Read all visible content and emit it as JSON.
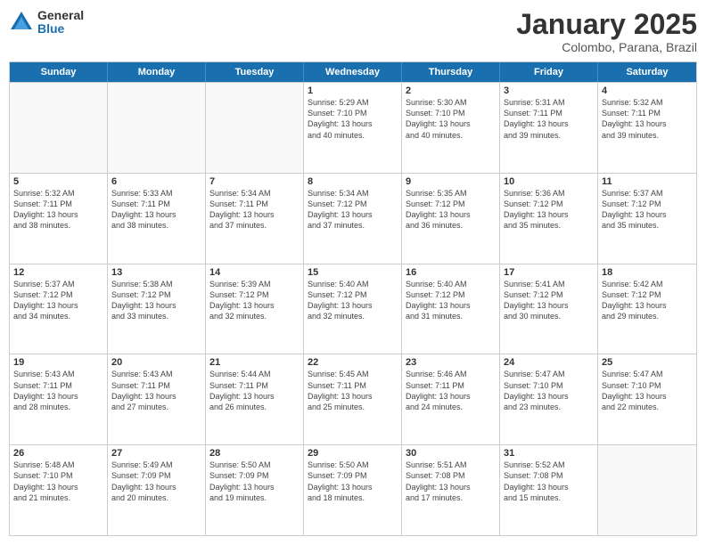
{
  "logo": {
    "general": "General",
    "blue": "Blue"
  },
  "title": "January 2025",
  "location": "Colombo, Parana, Brazil",
  "days_header": [
    "Sunday",
    "Monday",
    "Tuesday",
    "Wednesday",
    "Thursday",
    "Friday",
    "Saturday"
  ],
  "weeks": [
    [
      {
        "day": "",
        "info": ""
      },
      {
        "day": "",
        "info": ""
      },
      {
        "day": "",
        "info": ""
      },
      {
        "day": "1",
        "info": "Sunrise: 5:29 AM\nSunset: 7:10 PM\nDaylight: 13 hours\nand 40 minutes."
      },
      {
        "day": "2",
        "info": "Sunrise: 5:30 AM\nSunset: 7:10 PM\nDaylight: 13 hours\nand 40 minutes."
      },
      {
        "day": "3",
        "info": "Sunrise: 5:31 AM\nSunset: 7:11 PM\nDaylight: 13 hours\nand 39 minutes."
      },
      {
        "day": "4",
        "info": "Sunrise: 5:32 AM\nSunset: 7:11 PM\nDaylight: 13 hours\nand 39 minutes."
      }
    ],
    [
      {
        "day": "5",
        "info": "Sunrise: 5:32 AM\nSunset: 7:11 PM\nDaylight: 13 hours\nand 38 minutes."
      },
      {
        "day": "6",
        "info": "Sunrise: 5:33 AM\nSunset: 7:11 PM\nDaylight: 13 hours\nand 38 minutes."
      },
      {
        "day": "7",
        "info": "Sunrise: 5:34 AM\nSunset: 7:11 PM\nDaylight: 13 hours\nand 37 minutes."
      },
      {
        "day": "8",
        "info": "Sunrise: 5:34 AM\nSunset: 7:12 PM\nDaylight: 13 hours\nand 37 minutes."
      },
      {
        "day": "9",
        "info": "Sunrise: 5:35 AM\nSunset: 7:12 PM\nDaylight: 13 hours\nand 36 minutes."
      },
      {
        "day": "10",
        "info": "Sunrise: 5:36 AM\nSunset: 7:12 PM\nDaylight: 13 hours\nand 35 minutes."
      },
      {
        "day": "11",
        "info": "Sunrise: 5:37 AM\nSunset: 7:12 PM\nDaylight: 13 hours\nand 35 minutes."
      }
    ],
    [
      {
        "day": "12",
        "info": "Sunrise: 5:37 AM\nSunset: 7:12 PM\nDaylight: 13 hours\nand 34 minutes."
      },
      {
        "day": "13",
        "info": "Sunrise: 5:38 AM\nSunset: 7:12 PM\nDaylight: 13 hours\nand 33 minutes."
      },
      {
        "day": "14",
        "info": "Sunrise: 5:39 AM\nSunset: 7:12 PM\nDaylight: 13 hours\nand 32 minutes."
      },
      {
        "day": "15",
        "info": "Sunrise: 5:40 AM\nSunset: 7:12 PM\nDaylight: 13 hours\nand 32 minutes."
      },
      {
        "day": "16",
        "info": "Sunrise: 5:40 AM\nSunset: 7:12 PM\nDaylight: 13 hours\nand 31 minutes."
      },
      {
        "day": "17",
        "info": "Sunrise: 5:41 AM\nSunset: 7:12 PM\nDaylight: 13 hours\nand 30 minutes."
      },
      {
        "day": "18",
        "info": "Sunrise: 5:42 AM\nSunset: 7:12 PM\nDaylight: 13 hours\nand 29 minutes."
      }
    ],
    [
      {
        "day": "19",
        "info": "Sunrise: 5:43 AM\nSunset: 7:11 PM\nDaylight: 13 hours\nand 28 minutes."
      },
      {
        "day": "20",
        "info": "Sunrise: 5:43 AM\nSunset: 7:11 PM\nDaylight: 13 hours\nand 27 minutes."
      },
      {
        "day": "21",
        "info": "Sunrise: 5:44 AM\nSunset: 7:11 PM\nDaylight: 13 hours\nand 26 minutes."
      },
      {
        "day": "22",
        "info": "Sunrise: 5:45 AM\nSunset: 7:11 PM\nDaylight: 13 hours\nand 25 minutes."
      },
      {
        "day": "23",
        "info": "Sunrise: 5:46 AM\nSunset: 7:11 PM\nDaylight: 13 hours\nand 24 minutes."
      },
      {
        "day": "24",
        "info": "Sunrise: 5:47 AM\nSunset: 7:10 PM\nDaylight: 13 hours\nand 23 minutes."
      },
      {
        "day": "25",
        "info": "Sunrise: 5:47 AM\nSunset: 7:10 PM\nDaylight: 13 hours\nand 22 minutes."
      }
    ],
    [
      {
        "day": "26",
        "info": "Sunrise: 5:48 AM\nSunset: 7:10 PM\nDaylight: 13 hours\nand 21 minutes."
      },
      {
        "day": "27",
        "info": "Sunrise: 5:49 AM\nSunset: 7:09 PM\nDaylight: 13 hours\nand 20 minutes."
      },
      {
        "day": "28",
        "info": "Sunrise: 5:50 AM\nSunset: 7:09 PM\nDaylight: 13 hours\nand 19 minutes."
      },
      {
        "day": "29",
        "info": "Sunrise: 5:50 AM\nSunset: 7:09 PM\nDaylight: 13 hours\nand 18 minutes."
      },
      {
        "day": "30",
        "info": "Sunrise: 5:51 AM\nSunset: 7:08 PM\nDaylight: 13 hours\nand 17 minutes."
      },
      {
        "day": "31",
        "info": "Sunrise: 5:52 AM\nSunset: 7:08 PM\nDaylight: 13 hours\nand 15 minutes."
      },
      {
        "day": "",
        "info": ""
      }
    ]
  ]
}
